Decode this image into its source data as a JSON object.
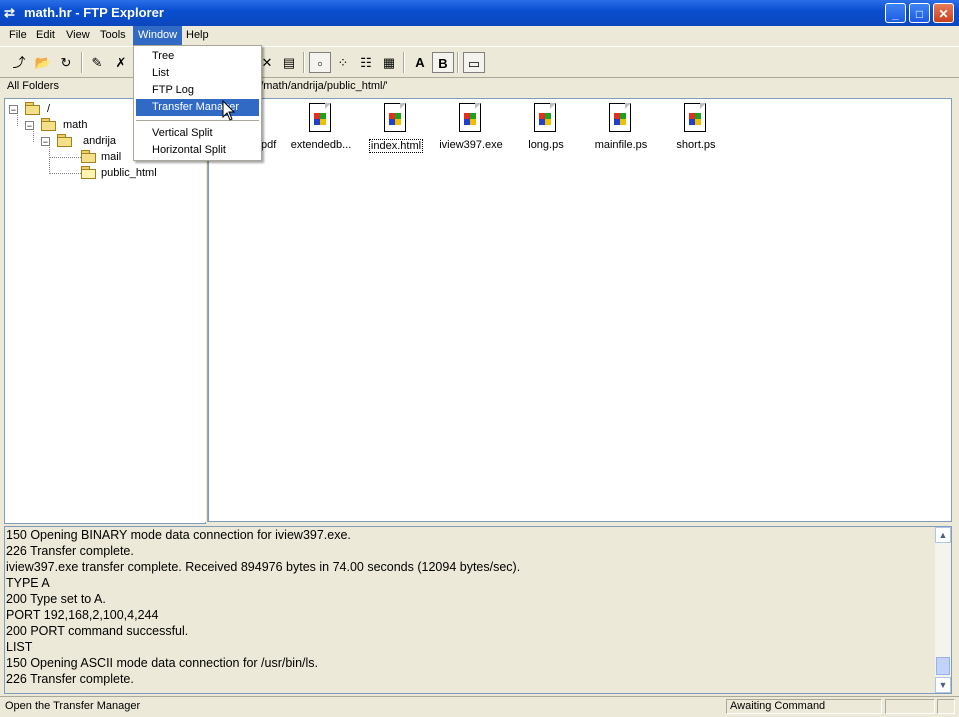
{
  "window": {
    "title": "math.hr - FTP Explorer",
    "controls": {
      "minimize": "_",
      "maximize": "□",
      "close": "✕"
    }
  },
  "menubar": {
    "items": [
      {
        "label": "File"
      },
      {
        "label": "Edit"
      },
      {
        "label": "View"
      },
      {
        "label": "Tools"
      },
      {
        "label": "Window"
      },
      {
        "label": "Help"
      }
    ]
  },
  "window_menu": {
    "items": [
      "Tree",
      "List",
      "FTP Log",
      "Transfer Manager",
      "Vertical Split",
      "Horizontal Split"
    ],
    "highlighted": "Transfer Manager"
  },
  "toolbar": {
    "font_a": "A",
    "font_b": "B"
  },
  "header": {
    "all_folders": "All Folders",
    "address": "f '/math/andrija/public_html/'"
  },
  "tree": {
    "nodes": [
      {
        "label": "/",
        "expander": "−"
      },
      {
        "label": "math",
        "expander": "−"
      },
      {
        "label": "andrija",
        "expander": "−"
      },
      {
        "label": "mail"
      },
      {
        "label": "public_html"
      }
    ]
  },
  "files": {
    "partial_label": "pdf",
    "items": [
      {
        "label": "extendedb..."
      },
      {
        "label": "index.html"
      },
      {
        "label": "iview397.exe"
      },
      {
        "label": "long.ps"
      },
      {
        "label": "mainfile.ps"
      },
      {
        "label": "short.ps"
      }
    ],
    "focused": "index.html"
  },
  "log": {
    "lines": [
      "150 Opening BINARY mode data connection for iview397.exe.",
      "226 Transfer complete.",
      "iview397.exe transfer complete.  Received 894976 bytes in 74.00 seconds (12094 bytes/sec).",
      "TYPE A",
      "200 Type set to A.",
      "PORT 192,168,2,100,4,244",
      "200 PORT command successful.",
      "LIST",
      "150 Opening ASCII mode data connection for /usr/bin/ls.",
      "226 Transfer complete."
    ]
  },
  "statusbar": {
    "message": "Open the Transfer Manager",
    "state": "Awaiting Command"
  }
}
